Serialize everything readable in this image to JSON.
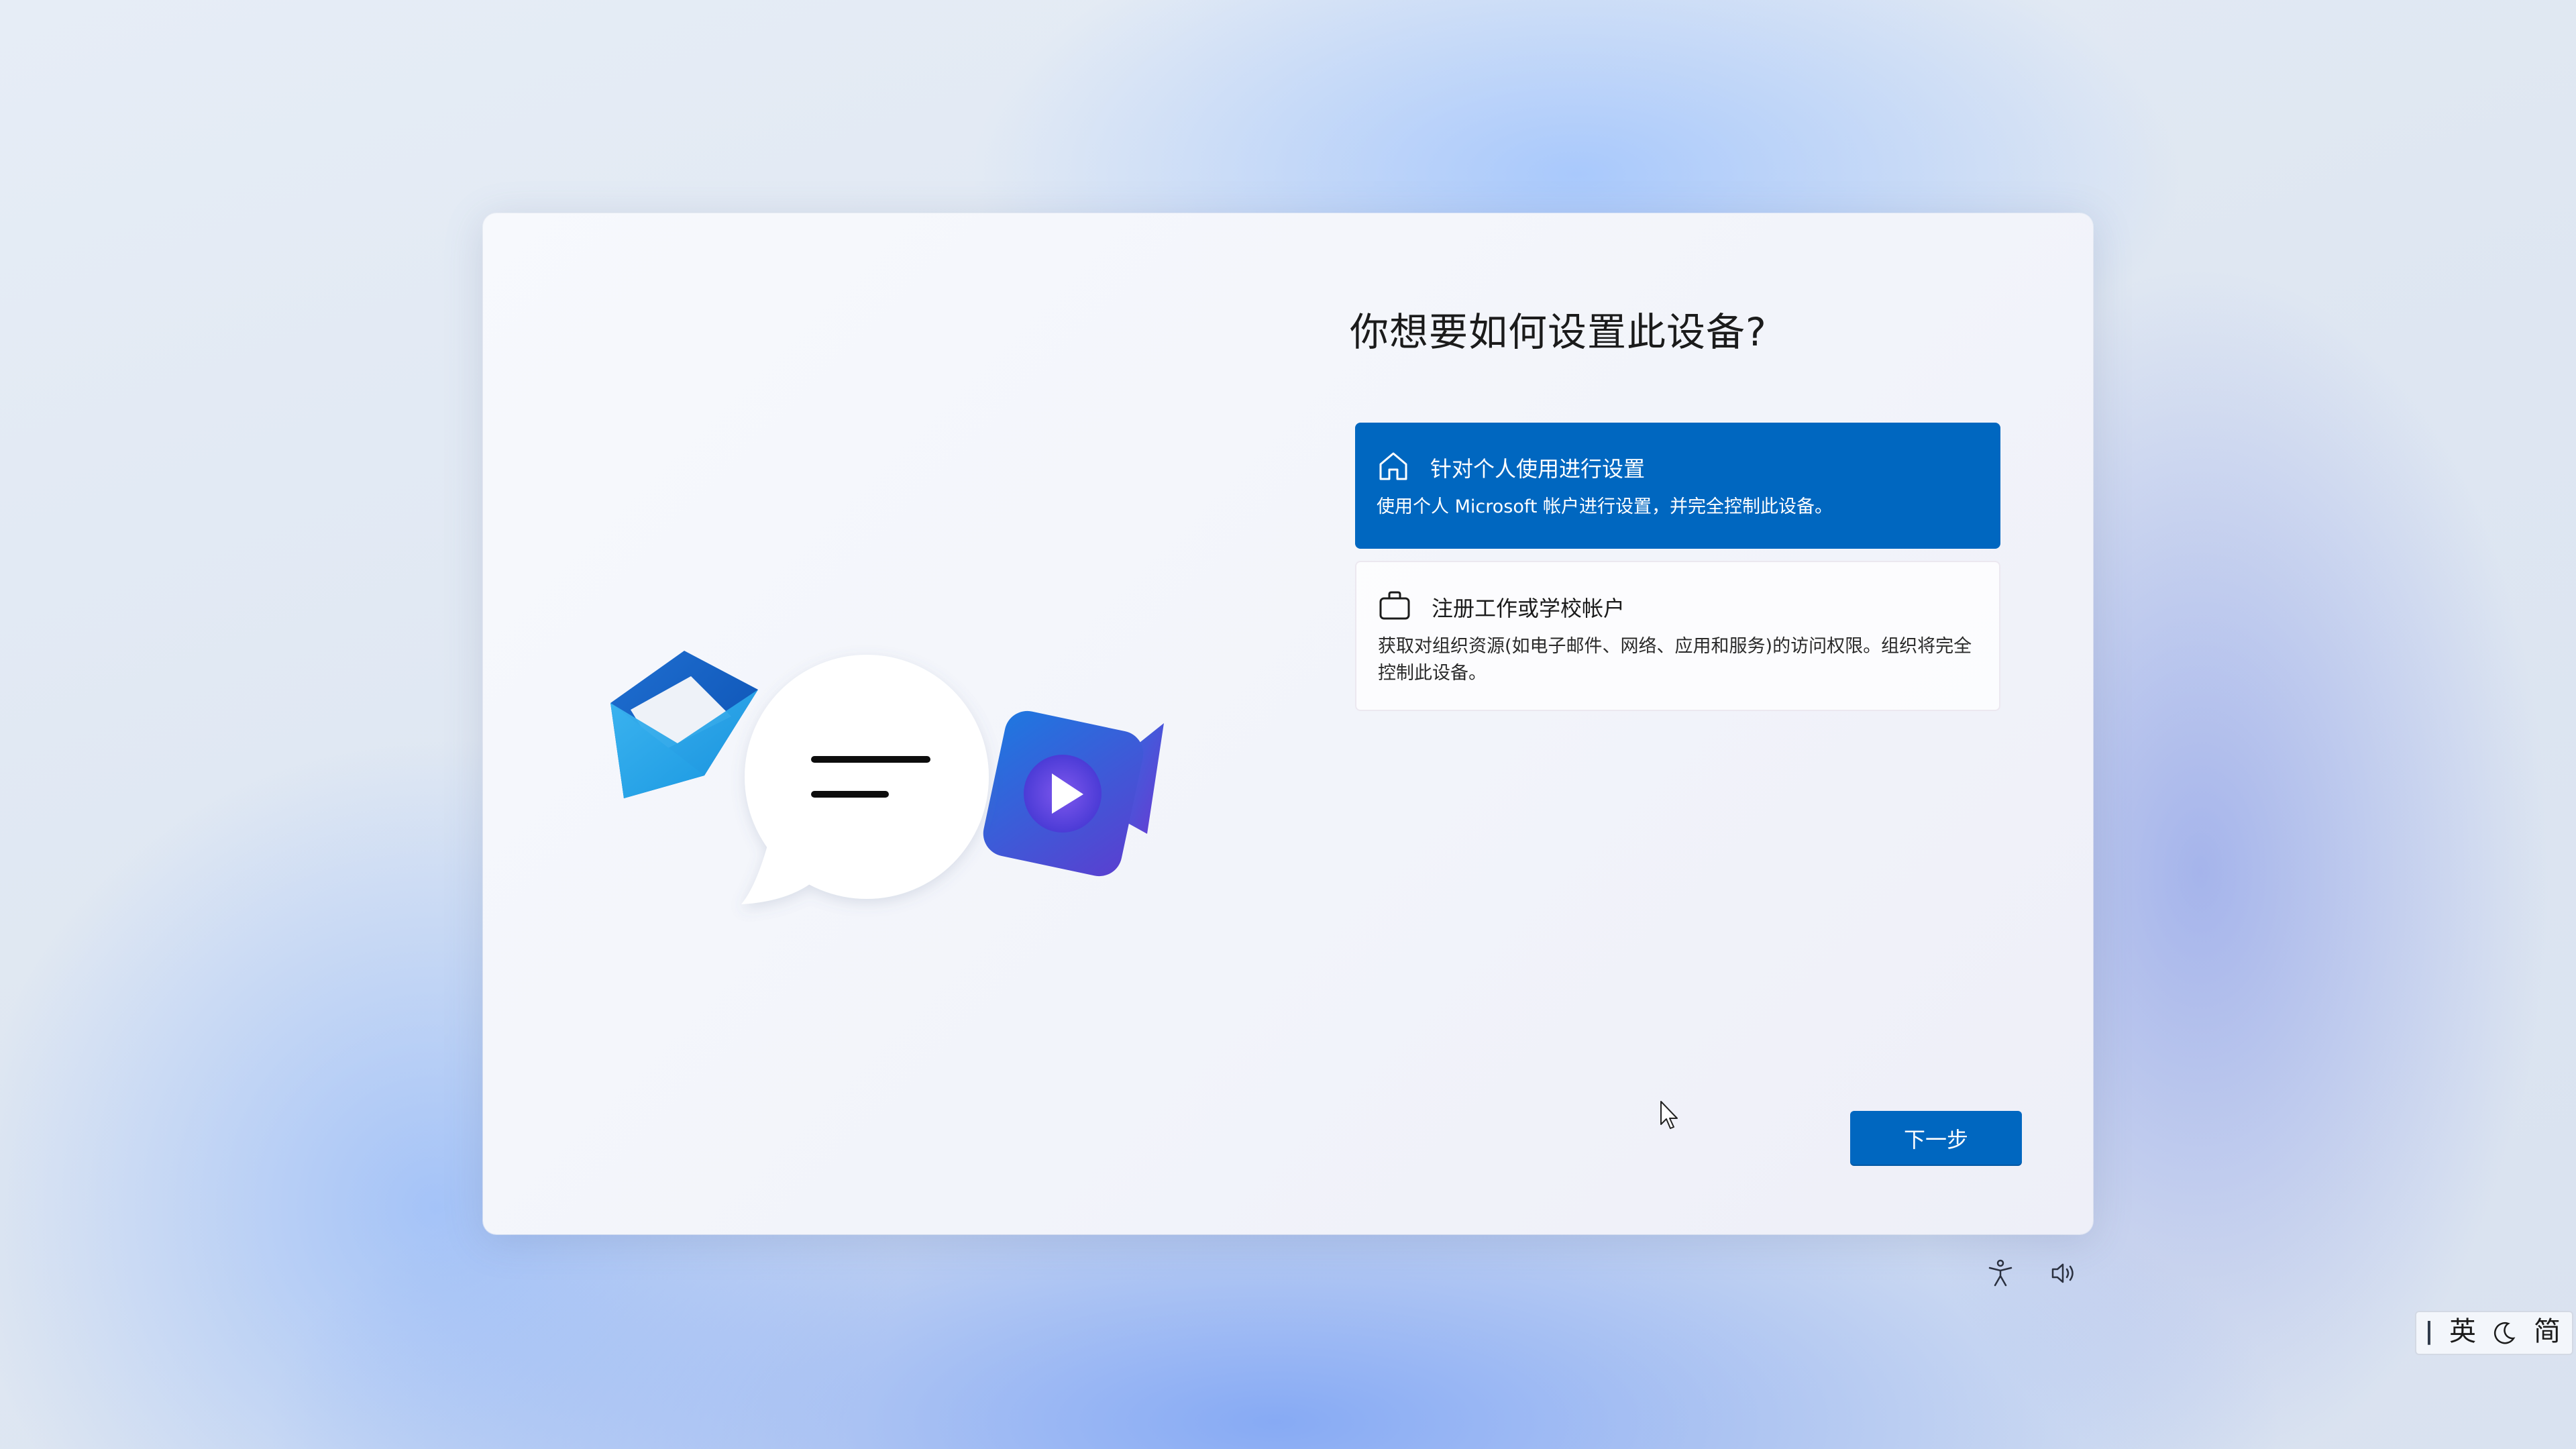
{
  "dialog": {
    "title": "你想要如何设置此设备?",
    "options": [
      {
        "icon": "home-icon",
        "title": "针对个人使用进行设置",
        "description": "使用个人 Microsoft 帐户进行设置，并完全控制此设备。",
        "selected": true
      },
      {
        "icon": "briefcase-icon",
        "title": "注册工作或学校帐户",
        "description": "获取对组织资源(如电子邮件、网络、应用和服务)的访问权限。组织将完全控制此设备。",
        "selected": false
      }
    ],
    "next_label": "下一步"
  },
  "illustration": {
    "icons": [
      "mail-icon",
      "chat-bubble-icon",
      "video-camera-icon"
    ]
  },
  "system_tray": {
    "icons": [
      "accessibility-icon",
      "volume-icon"
    ]
  },
  "ime": {
    "handle": "|",
    "language": "英",
    "mode_icon": "moon-icon",
    "script": "简"
  },
  "colors": {
    "accent": "#0067c0",
    "selected_text": "#ffffff",
    "title_text": "#1b1b1b"
  }
}
